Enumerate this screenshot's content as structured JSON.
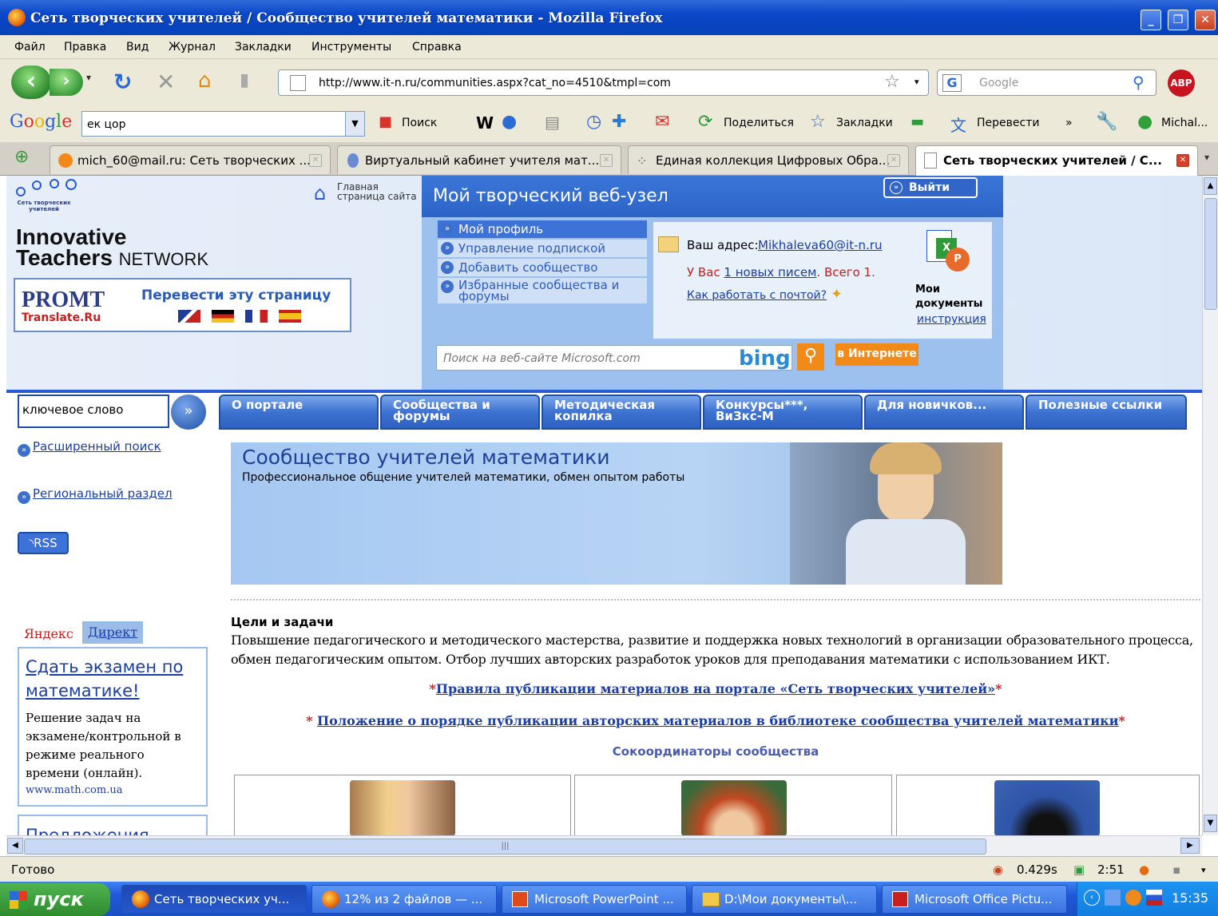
{
  "window": {
    "title": "Сеть творческих учителей / Сообщество учителей математики - Mozilla Firefox"
  },
  "menu": [
    "Файл",
    "Правка",
    "Вид",
    "Журнал",
    "Закладки",
    "Инструменты",
    "Справка"
  ],
  "nav": {
    "url": "http://www.it-n.ru/communities.aspx?cat_no=4510&tmpl=com",
    "search_placeholder": "Google",
    "abp": "ABP"
  },
  "google_bar": {
    "logo": "Google",
    "query": "ек цор",
    "search": "Поиск",
    "share": "Поделиться",
    "bookmarks": "Закладки",
    "translate": "Перевести",
    "user": "Michal..."
  },
  "tabs": [
    {
      "label": "mich_60@mail.ru: Сеть творческих ..."
    },
    {
      "label": "Виртуальный кабинет учителя мат..."
    },
    {
      "label": "Единая коллекция Цифровых Обра..."
    },
    {
      "label": "Сеть творческих учителей / С..."
    }
  ],
  "site": {
    "logo_small": "Сеть творческих учителей",
    "home_link": "Главная страница сайта",
    "brand_line1": "Innovative",
    "brand_line2": "Teachers",
    "brand_line3": "NETWORK",
    "promt": "PROMT",
    "promt_sub": "Translate.Ru",
    "translate_page": "Перевести эту страницу",
    "node_title": "Мой творческий веб-узел",
    "logout": "Выйти",
    "my_menu": [
      "Мой профиль",
      "Управление подпиской",
      "Добавить сообщество",
      "Избранные сообщества и форумы"
    ],
    "mail_label": "Ваш адрес:",
    "mail_address": "Mikhaleva60@it-n.ru",
    "mail_new_prefix": "У Вас",
    "mail_new_link": "1 новых писем",
    "mail_total": ". Всего 1.",
    "mail_howto": "Как работать с почтой?",
    "docs_title": "Мои документы",
    "docs_link": "инструкция",
    "ms_search_placeholder": "Поиск на веб-сайте Microsoft.com",
    "bing": "bing",
    "in_internet": "в Интернете",
    "keyword_placeholder": "ключевое слово",
    "nav_tabs": [
      "О портале",
      "Сообщества и форумы",
      "Методическая копилка",
      "Конкурсы***, ВиЗкс-М",
      "Для новичков...",
      "Полезные ссылки"
    ],
    "advanced_search": "Расширенный поиск",
    "regional": "Региональный раздел",
    "rss": "RSS"
  },
  "community": {
    "title": "Сообщество учителей математики",
    "subtitle": "Профессиональное общение учителей математики, обмен опытом работы",
    "goals_heading": "Цели и задачи",
    "goals_text": "Повышение педагогического и методического мастерства, развитие и поддержка новых технологий в организации образовательного процесса, обмен педагогическим опытом. Отбор лучших авторских разработок уроков для преподавания математики с использованием ИКТ.",
    "rules_link": "Правила публикации материалов на портале «Сеть творческих учителей»",
    "regulation_link": "Положение о порядке публикации авторских материалов в библиотеке сообщества учителей математики",
    "coordinators": "Сокоординаторы сообщества"
  },
  "ad": {
    "yandex": "Яндекс",
    "direct": "Директ",
    "title": "Сдать экзамен по математике!",
    "text": "Решение задач на экзамене/контрольной в режиме реального времени (онлайн).",
    "url": "www.math.com.ua",
    "next": "Предложения"
  },
  "status": {
    "text": "Готово",
    "timer": "0.429s",
    "clock2": "2:51"
  },
  "taskbar": {
    "start": "пуск",
    "items": [
      "Сеть творческих уч...",
      "12% из 2 файлов — ...",
      "Microsoft PowerPoint ...",
      "D:\\Мои документы\\...",
      "Microsoft Office Pictu..."
    ],
    "time": "15:35"
  }
}
